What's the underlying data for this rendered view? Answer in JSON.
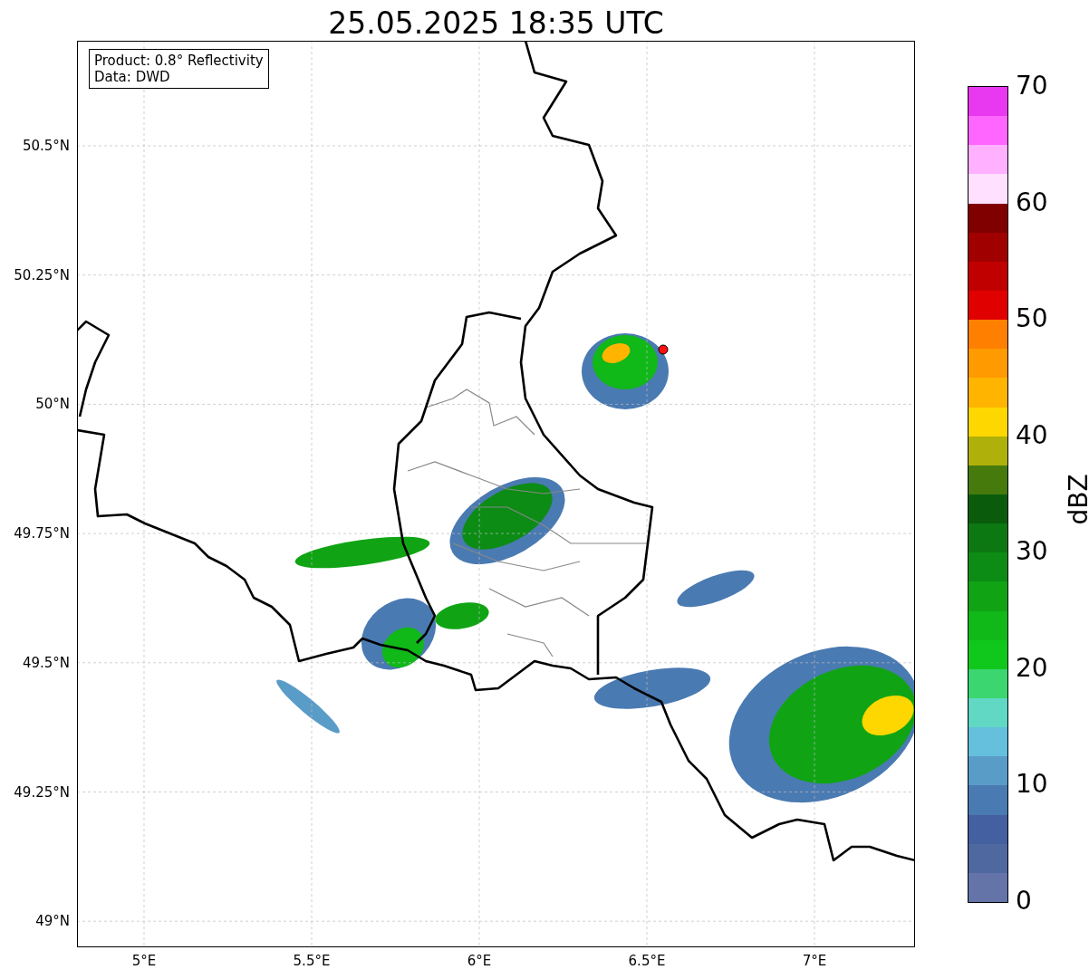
{
  "title": "25.05.2025 18:35 UTC",
  "map": {
    "info_box": [
      "Product: 0.8° Reflectivity",
      "Data: DWD"
    ],
    "xticks": [
      "5°E",
      "5.5°E",
      "6°E",
      "6.5°E",
      "7°E"
    ],
    "yticks": [
      "50.5°N",
      "50.25°N",
      "50°N",
      "49.75°N",
      "49.5°N",
      "49.25°N",
      "49°N"
    ]
  },
  "colorbar": {
    "label": "dBZ",
    "ticks": [
      "70",
      "60",
      "50",
      "40",
      "30",
      "20",
      "10",
      "0"
    ],
    "segments": [
      {
        "color": "#6474a8"
      },
      {
        "color": "#5068a0"
      },
      {
        "color": "#4460a0"
      },
      {
        "color": "#4a7ab2"
      },
      {
        "color": "#5a9cc8"
      },
      {
        "color": "#64c0dc"
      },
      {
        "color": "#60d8c4"
      },
      {
        "color": "#3cd670"
      },
      {
        "color": "#10c81c"
      },
      {
        "color": "#10b818"
      },
      {
        "color": "#10a414"
      },
      {
        "color": "#0c8c14"
      },
      {
        "color": "#0c7812"
      },
      {
        "color": "#0a5c0c"
      },
      {
        "color": "#467a0c"
      },
      {
        "color": "#b0b00a"
      },
      {
        "color": "#ffd700"
      },
      {
        "color": "#ffb400"
      },
      {
        "color": "#ff9a00"
      },
      {
        "color": "#ff8000"
      },
      {
        "color": "#e00000"
      },
      {
        "color": "#c00000"
      },
      {
        "color": "#a00000"
      },
      {
        "color": "#800000"
      },
      {
        "color": "#ffe0ff"
      },
      {
        "color": "#ffb0ff"
      },
      {
        "color": "#ff66ff"
      },
      {
        "color": "#e838f0"
      }
    ]
  }
}
